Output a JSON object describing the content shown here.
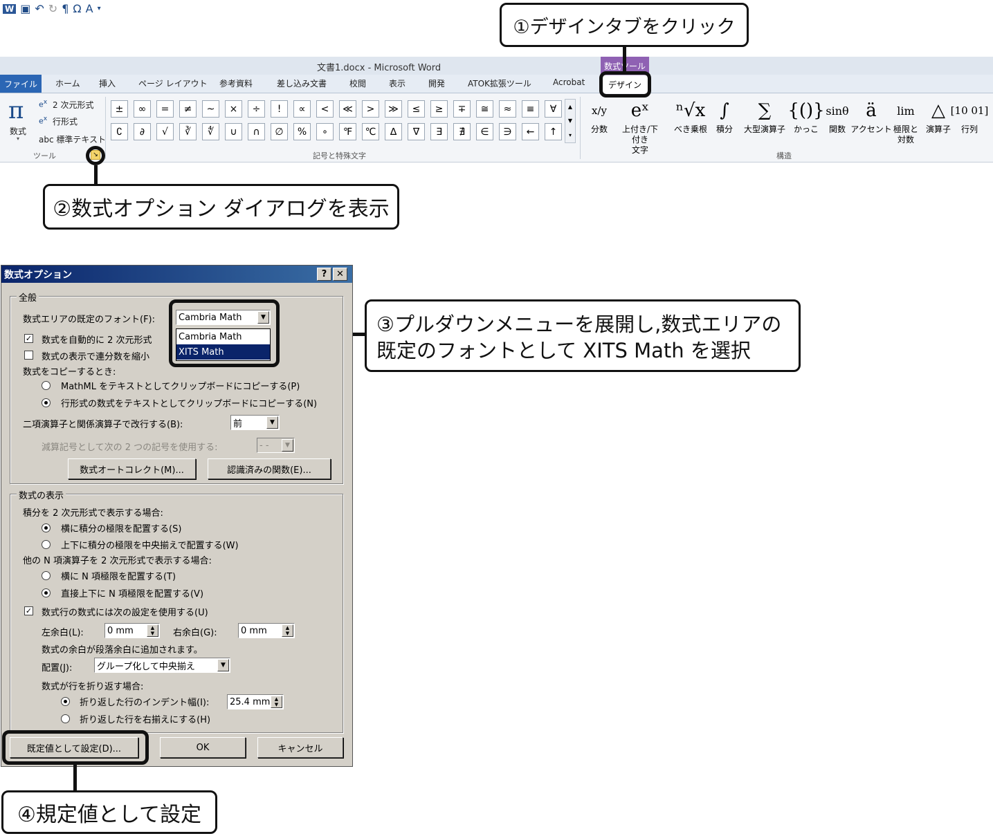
{
  "word": {
    "title": "文書1.docx - Microsoft Word",
    "tabs": [
      "ファイル",
      "ホーム",
      "挿入",
      "ページ レイアウト",
      "参考資料",
      "差し込み文書",
      "校閲",
      "表示",
      "開発",
      "ATOK拡張ツール",
      "Acrobat"
    ],
    "context_group": "数式ツール",
    "context_tab": "デザイン",
    "tools": {
      "equation_label": "数式",
      "professional": "2 次元形式",
      "linear": "行形式",
      "normal_text": "abc 標準テキスト",
      "group_label": "ツール"
    },
    "symbols": {
      "row1": [
        "±",
        "∞",
        "=",
        "≠",
        "~",
        "×",
        "÷",
        "!",
        "∝",
        "<",
        "≪",
        ">",
        "≫",
        "≤",
        "≥",
        "∓",
        "≅",
        "≈",
        "≡",
        "∀"
      ],
      "row2": [
        "∁",
        "∂",
        "√",
        "∛",
        "∜",
        "∪",
        "∩",
        "∅",
        "%",
        "∘",
        "℉",
        "℃",
        "∆",
        "∇",
        "∃",
        "∄",
        "∈",
        "∋",
        "←",
        "↑"
      ],
      "group_label": "記号と特殊文字"
    },
    "structures": [
      {
        "glyph": "x/y",
        "label": "分数"
      },
      {
        "glyph": "eˣ",
        "label": "上付き/下付き\n文字"
      },
      {
        "glyph": "ⁿ√x",
        "label": "べき乗根"
      },
      {
        "glyph": "∫",
        "label": "積分"
      },
      {
        "glyph": "∑",
        "label": "大型演算子"
      },
      {
        "glyph": "{()}",
        "label": "かっこ"
      },
      {
        "glyph": "sinθ",
        "label": "関数"
      },
      {
        "glyph": "ä",
        "label": "アクセント"
      },
      {
        "glyph": "lim",
        "label": "極限と\n対数"
      },
      {
        "glyph": "△",
        "label": "演算子"
      },
      {
        "glyph": "[10 01]",
        "label": "行列"
      }
    ],
    "structures_group_label": "構造"
  },
  "callouts": {
    "c1": "①デザインタブをクリック",
    "c2": "②数式オプション ダイアログを表示",
    "c3_line1": "③プルダウンメニューを展開し,数式エリアの",
    "c3_line2": "既定のフォントとして XITS Math を選択",
    "c4": "④規定値として設定"
  },
  "dialog": {
    "title": "数式オプション",
    "help": "?",
    "close": "✕",
    "general_legend": "全般",
    "default_font_label": "数式エリアの既定のフォント(F):",
    "default_font_value": "Cambria Math",
    "font_options": [
      "Cambria Math",
      "XITS Math"
    ],
    "auto_convert": "数式を自動的に 2 次元形式",
    "shrink_fractions": "数式の表示で連分数を縮小",
    "copy_heading": "数式をコピーするとき:",
    "copy_mathml": "MathML をテキストとしてクリップボードにコピーする(P)",
    "copy_linear": "行形式の数式をテキストとしてクリップボードにコピーする(N)",
    "break_label": "二項演算子と関係演算子で改行する(B):",
    "break_value": "前",
    "dup_label": "減算記号として次の 2 つの記号を使用する:",
    "dup_value": "- -",
    "autocorrect_btn": "数式オートコレクト(M)...",
    "functions_btn": "認識済みの関数(E)...",
    "display_legend": "数式の表示",
    "integral_heading": "積分を 2 次元形式で表示する場合:",
    "integral_side": "横に積分の極限を配置する(S)",
    "integral_center": "上下に積分の極限を中央揃えで配置する(W)",
    "nary_heading": "他の N 項演算子を 2 次元形式で表示する場合:",
    "nary_side": "横に N 項極限を配置する(T)",
    "nary_center": "直接上下に N 項極限を配置する(V)",
    "display_math": "数式行の数式には次の設定を使用する(U)",
    "left_margin_label": "左余白(L):",
    "left_margin_value": "0 mm",
    "right_margin_label": "右余白(G):",
    "right_margin_value": "0 mm",
    "margin_note": "数式の余白が段落余白に追加されます。",
    "justify_label": "配置(J):",
    "justify_value": "グループ化して中央揃え",
    "wrap_heading": "数式が行を折り返す場合:",
    "wrap_indent_label": "折り返した行のインデント幅(I):",
    "wrap_indent_value": "25.4 mm",
    "wrap_right": "折り返した行を右揃えにする(H)",
    "default_btn": "既定値として設定(D)...",
    "ok_btn": "OK",
    "cancel_btn": "キャンセル"
  }
}
